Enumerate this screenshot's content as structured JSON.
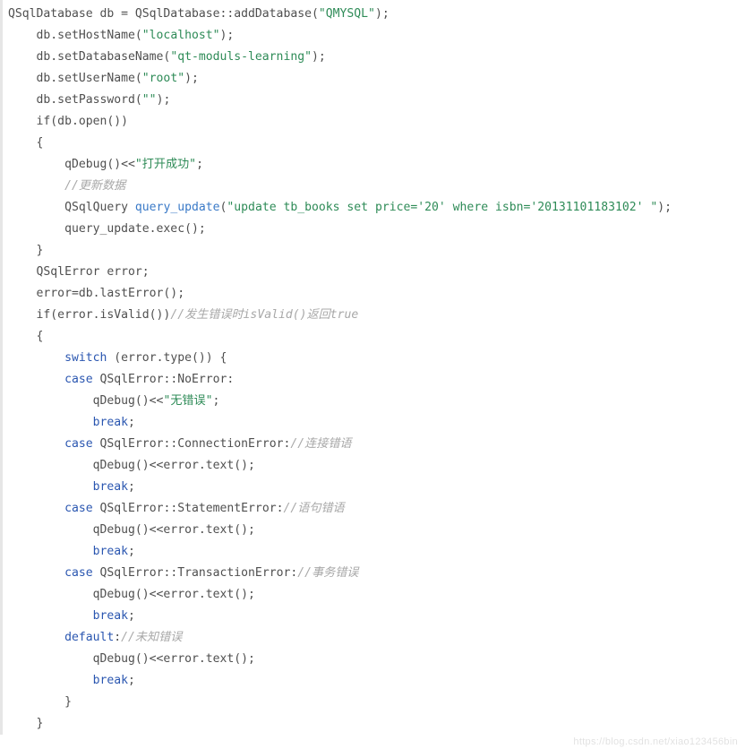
{
  "code": {
    "l01a": "QSqlDatabase db = QSqlDatabase::addDatabase(",
    "l01s": "\"QMYSQL\"",
    "l01b": ");",
    "l02a": "    db.setHostName(",
    "l02s": "\"localhost\"",
    "l02b": ");",
    "l03a": "    db.setDatabaseName(",
    "l03s": "\"qt-moduls-learning\"",
    "l03b": ");",
    "l04a": "    db.setUserName(",
    "l04s": "\"root\"",
    "l04b": ");",
    "l05a": "    db.setPassword(",
    "l05s": "\"\"",
    "l05b": ");",
    "l06": "    if(db.open())",
    "l07": "    {",
    "l08a": "        qDebug()<<",
    "l08s": "\"打开成功\"",
    "l08b": ";",
    "l09c": "        //更新数据",
    "l10a": "        QSqlQuery ",
    "l10v": "query_update",
    "l10b": "(",
    "l10s": "\"update tb_books set price='20' where isbn='20131101183102' \"",
    "l10c": ");",
    "l11": "        query_update.exec();",
    "l12": "    }",
    "l13": "    QSqlError error;",
    "l14": "    error=db.lastError();",
    "l15a": "    if(error.isValid())",
    "l15c": "//发生错误时isValid()返回true",
    "l16": "    {",
    "l17a": "        ",
    "l17k": "switch",
    "l17b": " (error.type()) {",
    "l18a": "        ",
    "l18k": "case",
    "l18b": " QSqlError::NoError:",
    "l19a": "            qDebug()<<",
    "l19s": "\"无错误\"",
    "l19b": ";",
    "l20a": "            ",
    "l20k": "break",
    "l20b": ";",
    "l21a": "        ",
    "l21k": "case",
    "l21b": " QSqlError::ConnectionError:",
    "l21c": "//连接错语",
    "l22": "            qDebug()<<error.text();",
    "l23a": "            ",
    "l23k": "break",
    "l23b": ";",
    "l24a": "        ",
    "l24k": "case",
    "l24b": " QSqlError::StatementError:",
    "l24c": "//语句错语",
    "l25": "            qDebug()<<error.text();",
    "l26a": "            ",
    "l26k": "break",
    "l26b": ";",
    "l27a": "        ",
    "l27k": "case",
    "l27b": " QSqlError::TransactionError:",
    "l27c": "//事务错误",
    "l28": "            qDebug()<<error.text();",
    "l29a": "            ",
    "l29k": "break",
    "l29b": ";",
    "l30a": "        ",
    "l30k": "default",
    "l30b": ":",
    "l30c": "//未知错误",
    "l31": "            qDebug()<<error.text();",
    "l32a": "            ",
    "l32k": "break",
    "l32b": ";",
    "l33": "        }",
    "l34": "    }"
  },
  "watermark": "https://blog.csdn.net/xiao123456bin"
}
